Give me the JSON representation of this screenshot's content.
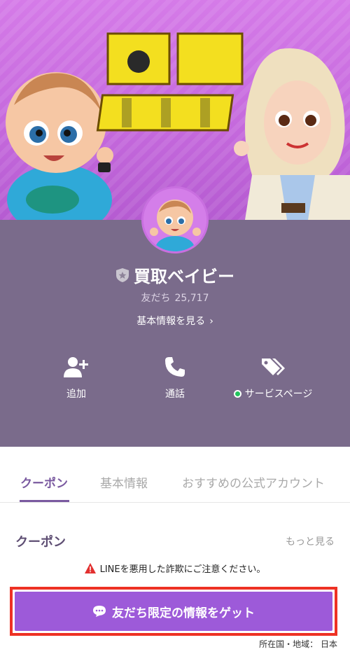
{
  "cover": {
    "logo_text": "買取ベイビー"
  },
  "profile": {
    "name": "買取ベイビー",
    "friends_label": "友だち",
    "friends_count": "25,717",
    "basic_info_link": "基本情報を見る"
  },
  "actions": [
    {
      "label": "追加",
      "icon": "add-friend-icon"
    },
    {
      "label": "通話",
      "icon": "phone-icon"
    },
    {
      "label": "サービスページ",
      "icon": "tag-icon"
    }
  ],
  "tabs": [
    {
      "label": "クーポン",
      "active": true
    },
    {
      "label": "基本情報",
      "active": false
    },
    {
      "label": "おすすめの公式アカウント",
      "active": false
    }
  ],
  "coupon": {
    "title": "クーポン",
    "more_label": "もっと見る",
    "warning": "LINEを悪用した詐欺にご注意ください。",
    "cta_label": "友だち限定の情報をゲット"
  },
  "footer": {
    "country_label": "所在国・地域： 日本"
  },
  "colors": {
    "cover_bg": "#c468dc",
    "profile_bg": "#7a6b8b",
    "accent": "#7a5aa0",
    "cta_bg": "#9d5ad9",
    "highlight_border": "#ee3124",
    "logo_yellow": "#f3df1f"
  }
}
